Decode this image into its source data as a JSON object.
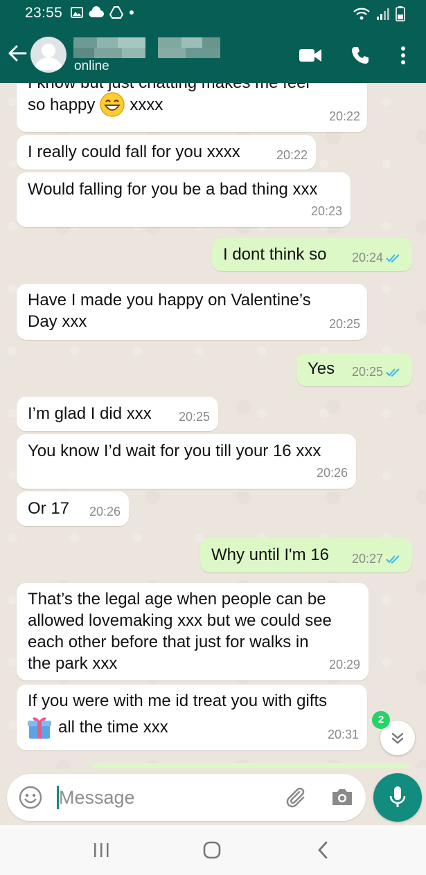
{
  "status_bar": {
    "time": "23:55"
  },
  "header": {
    "contact_status": "online"
  },
  "messages": [
    {
      "dir": "in",
      "text": "I know but just chatting makes me feel",
      "time": ""
    },
    {
      "dir": "in",
      "text": "so happy",
      "text_after_emoji": "xxxx",
      "emoji": "grinning-face",
      "time": "20:22"
    },
    {
      "dir": "in",
      "text": "I really could fall for you xxxx",
      "time": "20:22"
    },
    {
      "dir": "in",
      "text": "Would falling for you be a bad thing xxx",
      "time": "20:23"
    },
    {
      "dir": "out",
      "text": "I dont think so",
      "time": "20:24",
      "read": true
    },
    {
      "dir": "in",
      "text": "Have I made you happy on Valentine’s\nDay xxx",
      "time": "20:25"
    },
    {
      "dir": "out",
      "text": "Yes",
      "time": "20:25",
      "read": true
    },
    {
      "dir": "in",
      "text": "I’m glad I did xxx",
      "time": "20:25"
    },
    {
      "dir": "in",
      "text": "You know I’d wait for you till your 16 xxx",
      "time": "20:26"
    },
    {
      "dir": "in",
      "text": "Or 17",
      "time": "20:26"
    },
    {
      "dir": "out",
      "text": "Why until I'm 16",
      "time": "20:27",
      "read": true
    },
    {
      "dir": "in",
      "text": "That’s the legal age when people can be\nallowed lovemaking xxx but we could see\neach other before that just for walks in\nthe park xxx",
      "time": "20:29"
    },
    {
      "dir": "in",
      "text": "If you were with me id treat you with gifts",
      "text_line2": "all the time xxx",
      "emoji": "gift",
      "time": "20:31"
    }
  ],
  "scroll_button": {
    "unread_count": "2"
  },
  "composer": {
    "placeholder": "Message"
  },
  "colors": {
    "header": "#075e54",
    "outgoing": "#dcf8c6",
    "incoming": "#ffffff",
    "accent": "#128c7e",
    "badge": "#25d366",
    "read_ticks": "#34b7f1"
  },
  "icons": [
    "back-arrow-icon",
    "video-call-icon",
    "phone-icon",
    "more-options-icon",
    "emoji-icon",
    "attach-icon",
    "camera-icon",
    "mic-icon",
    "chevron-down-icon"
  ]
}
